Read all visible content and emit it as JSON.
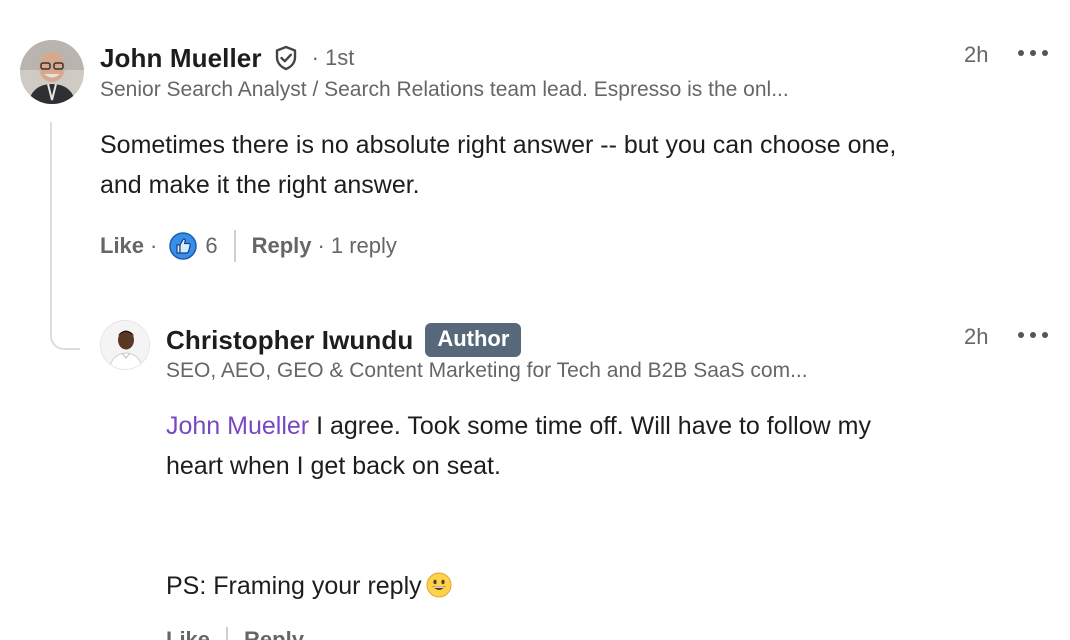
{
  "comment": {
    "author_name": "John Mueller",
    "degree": "1st",
    "headline": "Senior Search Analyst / Search Relations team lead. Espresso is the onl...",
    "time": "2h",
    "text_line1": "Sometimes there is no absolute right answer -- but you can choose one,",
    "text_line2": "and make it the right answer.",
    "like_label": "Like",
    "like_count": "6",
    "reply_label": "Reply",
    "reply_count": "1 reply"
  },
  "reply": {
    "author_name": "Christopher Iwundu",
    "badge": "Author",
    "headline": "SEO, AEO, GEO & Content Marketing for Tech and B2B SaaS com...",
    "time": "2h",
    "mention": "John Mueller",
    "text_line1": " I agree. Took some time off. Will have to follow my",
    "text_line2": "heart when I get back on seat.",
    "text_ps": "PS: Framing your reply",
    "like_label": "Like",
    "reply_label": "Reply"
  },
  "icons": {
    "verified": "shield-check-icon",
    "more": "more-horizontal-icon",
    "like": "like-thumb-icon",
    "emoji": "grinning-face-emoji"
  },
  "colors": {
    "mention": "#7848c0",
    "badge_bg": "#56687a",
    "like_blue": "#378fe9"
  }
}
